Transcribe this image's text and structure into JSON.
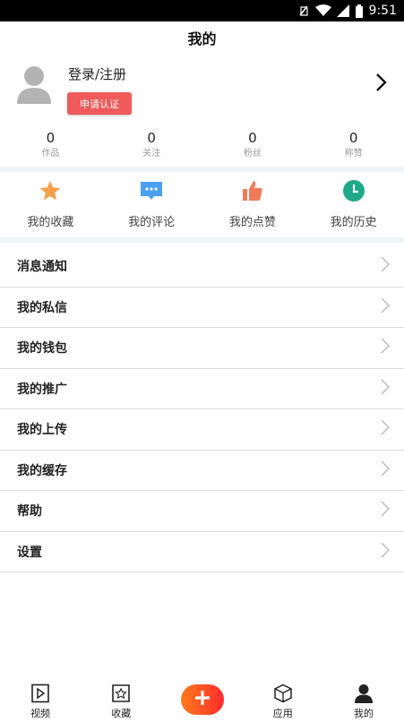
{
  "status_bar": {
    "time": "9:51"
  },
  "header": {
    "title": "我的"
  },
  "profile": {
    "login_label": "登录/注册",
    "apply_button": "申请认证"
  },
  "stats": [
    {
      "value": "0",
      "label": "作品"
    },
    {
      "value": "0",
      "label": "关注"
    },
    {
      "value": "0",
      "label": "粉丝"
    },
    {
      "value": "0",
      "label": "称赞"
    }
  ],
  "shortcuts": [
    {
      "label": "我的收藏",
      "icon": "star-icon",
      "color": "#f5a04a"
    },
    {
      "label": "我的评论",
      "icon": "comment-icon",
      "color": "#4a9ff0"
    },
    {
      "label": "我的点赞",
      "icon": "thumbs-up-icon",
      "color": "#f07a5a"
    },
    {
      "label": "我的历史",
      "icon": "clock-icon",
      "color": "#1fa88a"
    }
  ],
  "menu": [
    {
      "label": "消息通知"
    },
    {
      "label": "我的私信"
    },
    {
      "label": "我的钱包"
    },
    {
      "label": "我的推广"
    },
    {
      "label": "我的上传"
    },
    {
      "label": "我的缓存"
    },
    {
      "label": "帮助"
    },
    {
      "label": "设置"
    }
  ],
  "tabbar": {
    "items": [
      {
        "label": "视频",
        "icon": "video-icon"
      },
      {
        "label": "收藏",
        "icon": "favorite-icon"
      },
      {
        "label": "",
        "icon": "plus-icon"
      },
      {
        "label": "应用",
        "icon": "cube-icon"
      },
      {
        "label": "我的",
        "icon": "user-icon"
      }
    ]
  }
}
